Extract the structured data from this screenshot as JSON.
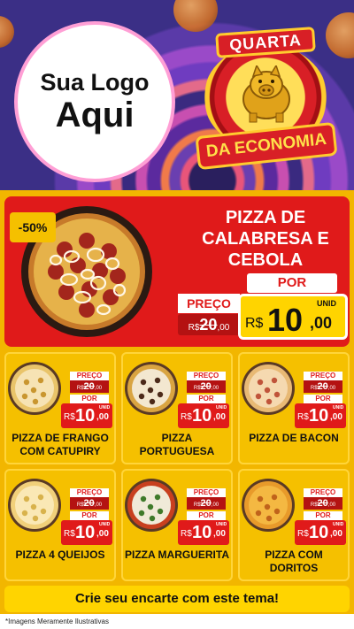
{
  "header": {
    "logo_line1": "Sua Logo",
    "logo_line2": "Aqui",
    "badge_top": "QUARTA",
    "badge_bottom": "DA ECONOMIA"
  },
  "featured": {
    "discount": "-50%",
    "title": "PIZZA DE CALABRESA E CEBOLA",
    "por_label": "POR",
    "preco_label": "PREÇO",
    "old_currency": "R$",
    "old_int": "20",
    "old_dec": ",00",
    "unid_label": "UNID",
    "new_currency": "R$",
    "new_int": "10",
    "new_dec": ",00"
  },
  "cards": [
    {
      "name": "PIZZA DE FRANGO COM CATUPIRY",
      "preco_label": "PREÇO",
      "old_currency": "R$",
      "old_int": "20",
      "old_dec": ",00",
      "por_label": "POR",
      "unid_label": "UNID",
      "new_currency": "R$",
      "new_int": "10",
      "new_dec": ",00",
      "pizza_style": "frango"
    },
    {
      "name": "PIZZA PORTUGUESA",
      "preco_label": "PREÇO",
      "old_currency": "R$",
      "old_int": "20",
      "old_dec": ",00",
      "por_label": "POR",
      "unid_label": "UNID",
      "new_currency": "R$",
      "new_int": "10",
      "new_dec": ",00",
      "pizza_style": "portuguesa"
    },
    {
      "name": "PIZZA DE BACON",
      "preco_label": "PREÇO",
      "old_currency": "R$",
      "old_int": "20",
      "old_dec": ",00",
      "por_label": "POR",
      "unid_label": "UNID",
      "new_currency": "R$",
      "new_int": "10",
      "new_dec": ",00",
      "pizza_style": "bacon"
    },
    {
      "name": "PIZZA 4 QUEIJOS",
      "preco_label": "PREÇO",
      "old_currency": "R$",
      "old_int": "20",
      "old_dec": ",00",
      "por_label": "POR",
      "unid_label": "UNID",
      "new_currency": "R$",
      "new_int": "10",
      "new_dec": ",00",
      "pizza_style": "queijos"
    },
    {
      "name": "PIZZA MARGUERITA",
      "preco_label": "PREÇO",
      "old_currency": "R$",
      "old_int": "20",
      "old_dec": ",00",
      "por_label": "POR",
      "unid_label": "UNID",
      "new_currency": "R$",
      "new_int": "10",
      "new_dec": ",00",
      "pizza_style": "marguerita"
    },
    {
      "name": "PIZZA COM DORITOS",
      "preco_label": "PREÇO",
      "old_currency": "R$",
      "old_int": "20",
      "old_dec": ",00",
      "por_label": "POR",
      "unid_label": "UNID",
      "new_currency": "R$",
      "new_int": "10",
      "new_dec": ",00",
      "pizza_style": "doritos"
    }
  ],
  "cta": "Crie seu encarte com este tema!",
  "footnote": "*Imagens Meramente Ilustrativas",
  "colors": {
    "red": "#e01a1a",
    "yellow": "#f5c000",
    "bright_yellow": "#ffd400",
    "dark_red": "#b41212"
  }
}
